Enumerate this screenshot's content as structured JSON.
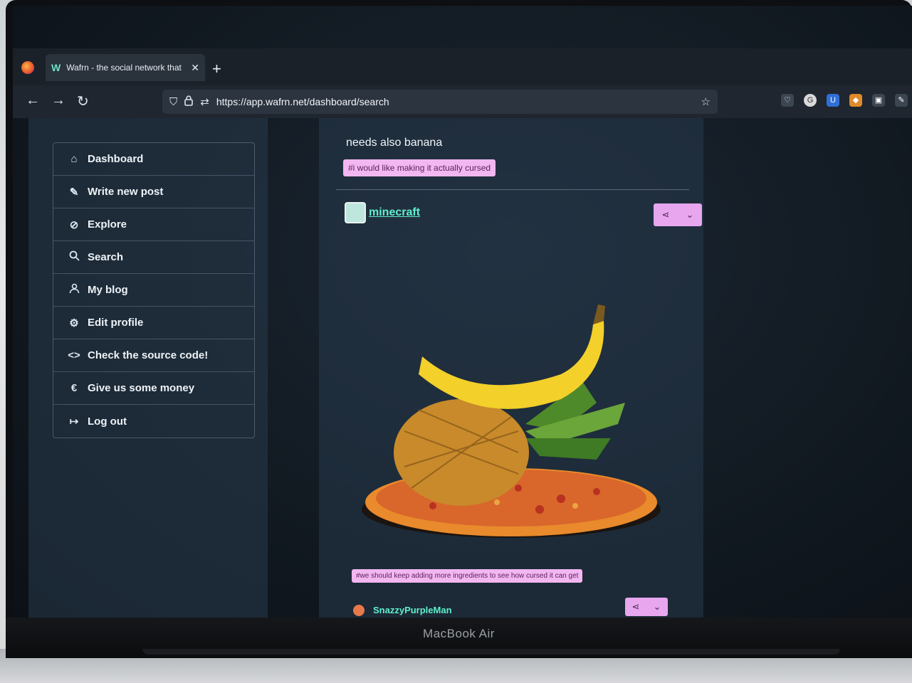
{
  "device": {
    "label": "MacBook Air"
  },
  "browser": {
    "tab": {
      "title": "Wafrn - the social network that",
      "favicon": "W",
      "close": "✕"
    },
    "new_tab": "+",
    "url": "https://app.wafrn.net/dashboard/search",
    "nav": {
      "back": "←",
      "forward": "→",
      "reload": "↻"
    }
  },
  "sidebar": {
    "items": [
      {
        "label": "Dashboard",
        "icon": "home-icon"
      },
      {
        "label": "Write new post",
        "icon": "pencil-icon"
      },
      {
        "label": "Explore",
        "icon": "compass-icon"
      },
      {
        "label": "Search",
        "icon": "search-icon"
      },
      {
        "label": "My blog",
        "icon": "user-icon"
      },
      {
        "label": "Edit profile",
        "icon": "gear-icon"
      },
      {
        "label": "Check the source code!",
        "icon": "code-icon"
      },
      {
        "label": "Give us some money",
        "icon": "euro-icon"
      },
      {
        "label": "Log out",
        "icon": "logout-icon"
      }
    ]
  },
  "feed": {
    "post1": {
      "text": "needs also banana",
      "tag": "#i would like making it actually cursed"
    },
    "post2": {
      "username": "minecraft",
      "tag": "#we should keep adding more ingredients to see how cursed it can get"
    },
    "post3": {
      "username": "SnazzyPurpleMan"
    }
  },
  "colors": {
    "accent": "#f2b6f0",
    "username": "#5ff0cc",
    "background": "#121a22"
  }
}
